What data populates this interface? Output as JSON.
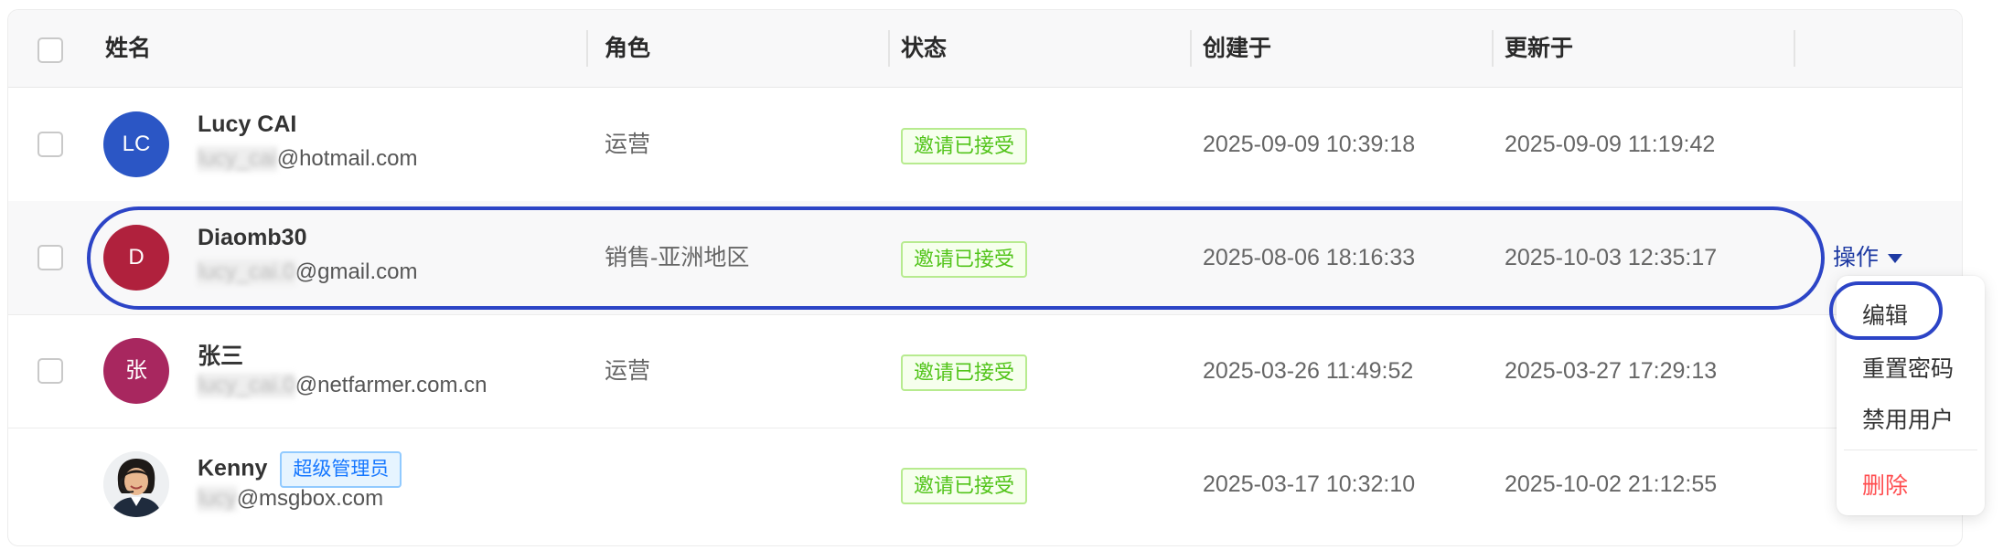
{
  "columns": {
    "name": "姓名",
    "role": "角色",
    "status": "状态",
    "created": "创建于",
    "updated": "更新于"
  },
  "users": [
    {
      "initials": "LC",
      "avatar_color": "#2b56c5",
      "name": "Lucy CAI",
      "email_masked": "lucy_cai",
      "email_domain": "@hotmail.com",
      "role": "运营",
      "status": "邀请已接受",
      "created": "2025-09-09 10:39:18",
      "updated": "2025-09-09 11:19:42"
    },
    {
      "initials": "D",
      "avatar_color": "#b0213d",
      "name": "Diaomb30",
      "email_masked": "lucy_cai.0",
      "email_domain": "@gmail.com",
      "role": "销售-亚洲地区",
      "status": "邀请已接受",
      "created": "2025-08-06 18:16:33",
      "updated": "2025-10-03 12:35:17"
    },
    {
      "initials": "张",
      "avatar_color": "#a8275f",
      "name": "张三",
      "email_masked": "lucy_cai.0",
      "email_domain": "@netfarmer.com.cn",
      "role": "运营",
      "status": "邀请已接受",
      "created": "2025-03-26 11:49:52",
      "updated": "2025-03-27 17:29:13"
    },
    {
      "initials": "",
      "avatar_color": "#f3f3f3",
      "name": "Kenny",
      "badge": "超级管理员",
      "email_masked": "lucy",
      "email_domain": "@msgbox.com",
      "role": "",
      "status": "邀请已接受",
      "created": "2025-03-17 10:32:10",
      "updated": "2025-10-02 21:12:55"
    }
  ],
  "actions": {
    "label": "操作",
    "menu": [
      "编辑",
      "重置密码",
      "禁用用户",
      "删除"
    ]
  },
  "colors": {
    "highlight": "#2c44c6",
    "success": "#52c41a",
    "danger": "#ff4d4f",
    "link": "#1e3aa3"
  }
}
